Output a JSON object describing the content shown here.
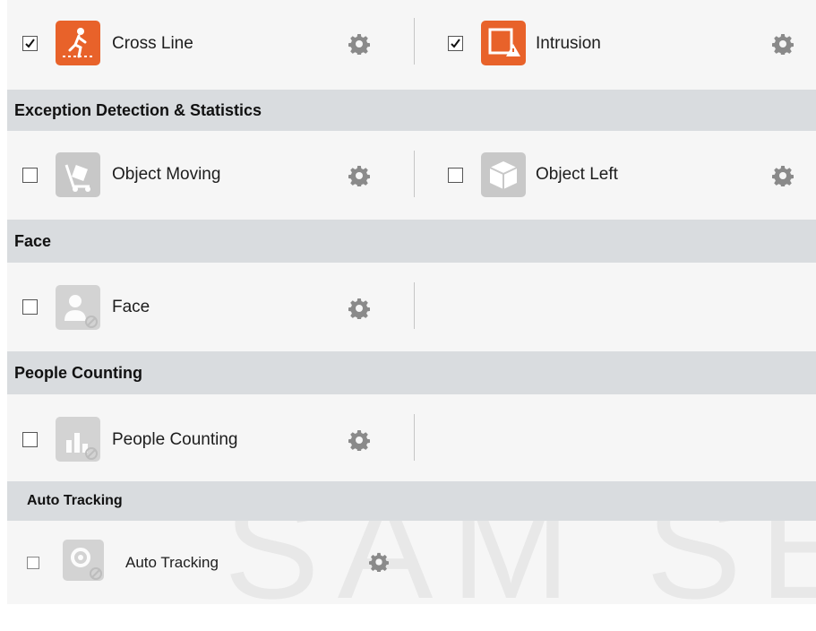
{
  "rows": {
    "cross_line": {
      "label": "Cross Line",
      "checked": true
    },
    "intrusion": {
      "label": "Intrusion",
      "checked": true
    },
    "object_moving": {
      "label": "Object Moving",
      "checked": false
    },
    "object_left": {
      "label": "Object Left",
      "checked": false
    },
    "face": {
      "label": "Face",
      "checked": false
    },
    "people_counting": {
      "label": "People Counting",
      "checked": false
    },
    "auto_tracking": {
      "label": "Auto Tracking",
      "checked": false
    }
  },
  "sections": {
    "exception": "Exception Detection & Statistics",
    "face": "Face",
    "people_counting": "People Counting",
    "auto_tracking": "Auto Tracking"
  },
  "watermark": "SAM SEC",
  "colors": {
    "active_tile": "#e8622a",
    "inactive_tile": "#c8c8c8",
    "section_bg": "#d9dcdf"
  }
}
